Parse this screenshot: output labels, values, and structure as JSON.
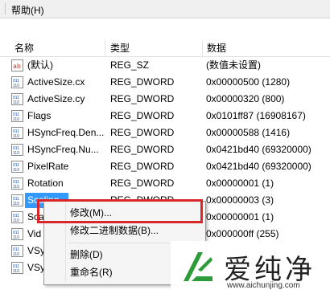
{
  "menubar": {
    "help_label": "帮助(H)"
  },
  "header": {
    "name": "名称",
    "type": "类型",
    "data": "数据"
  },
  "rows": [
    {
      "name": "(默认)",
      "type": "REG_SZ",
      "data": "(数值未设置)",
      "icon": "ab"
    },
    {
      "name": "ActiveSize.cx",
      "type": "REG_DWORD",
      "data": "0x00000500 (1280)",
      "icon": "bin"
    },
    {
      "name": "ActiveSize.cy",
      "type": "REG_DWORD",
      "data": "0x00000320 (800)",
      "icon": "bin"
    },
    {
      "name": "Flags",
      "type": "REG_DWORD",
      "data": "0x0101ff87 (16908167)",
      "icon": "bin"
    },
    {
      "name": "HSyncFreq.Den...",
      "type": "REG_DWORD",
      "data": "0x00000588 (1416)",
      "icon": "bin"
    },
    {
      "name": "HSyncFreq.Nu...",
      "type": "REG_DWORD",
      "data": "0x0421bd40 (69320000)",
      "icon": "bin"
    },
    {
      "name": "PixelRate",
      "type": "REG_DWORD",
      "data": "0x0421bd40 (69320000)",
      "icon": "bin"
    },
    {
      "name": "Rotation",
      "type": "REG_DWORD",
      "data": "0x00000001 (1)",
      "icon": "bin"
    },
    {
      "name": "Scaling",
      "type": "REG_DWORD",
      "data": "0x00000003 (3)",
      "icon": "bin"
    },
    {
      "name": "Sca",
      "type": "",
      "data": "0x00000001 (1)",
      "icon": "bin"
    },
    {
      "name": "Vid",
      "type": "",
      "data": "0x000000ff (255)",
      "icon": "bin"
    },
    {
      "name": "VSy",
      "type": "",
      "data": "",
      "icon": "bin"
    },
    {
      "name": "VSy",
      "type": "",
      "data": "",
      "icon": "bin"
    }
  ],
  "context_menu": {
    "modify": "修改(M)...",
    "modify_binary": "修改二进制数据(B)...",
    "delete": "删除(D)",
    "rename": "重命名(R)"
  },
  "watermark": {
    "brand": "爱纯净",
    "url": "www.aichunjing.com"
  },
  "colors": {
    "selection": "#3399ff",
    "highlight_box": "#d9262b",
    "logo_green": "#2e9b3a"
  }
}
